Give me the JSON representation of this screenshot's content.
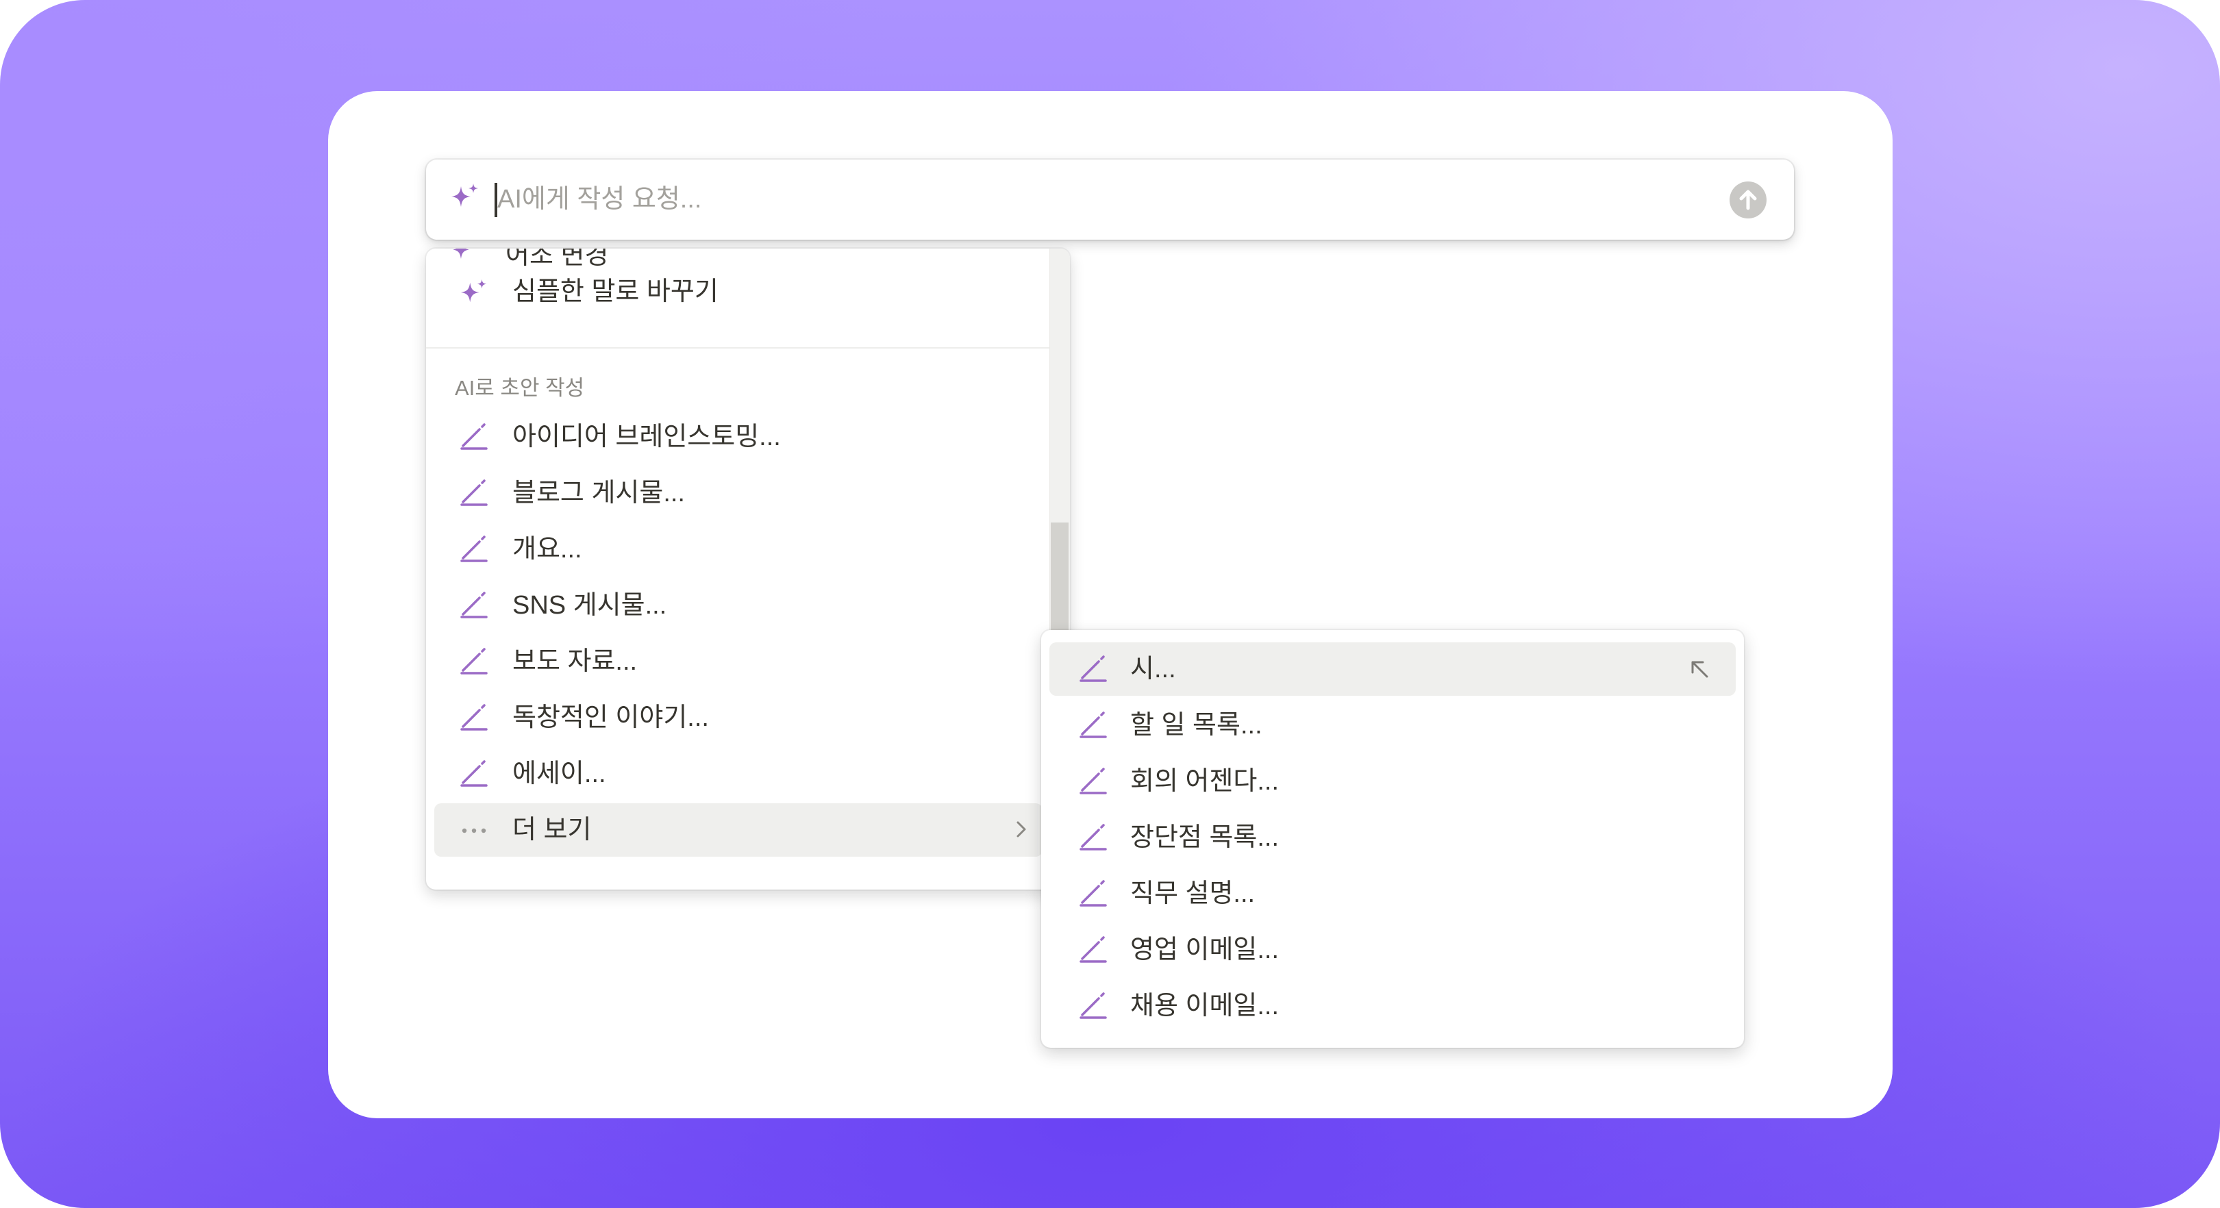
{
  "prompt": {
    "placeholder": "AI에게 작성 요청..."
  },
  "left_menu": {
    "partial_item_label": "어조 변경",
    "items_top": [
      {
        "label": "심플한 말로 바꾸기",
        "icon": "sparkle-icon"
      }
    ],
    "section_title": "AI로 초안 작성",
    "items": [
      {
        "label": "아이디어 브레인스토밍...",
        "icon": "pencil-icon"
      },
      {
        "label": "블로그 게시물...",
        "icon": "pencil-icon"
      },
      {
        "label": "개요...",
        "icon": "pencil-icon"
      },
      {
        "label": "SNS 게시물...",
        "icon": "pencil-icon"
      },
      {
        "label": "보도 자료...",
        "icon": "pencil-icon"
      },
      {
        "label": "독창적인 이야기...",
        "icon": "pencil-icon"
      },
      {
        "label": "에세이...",
        "icon": "pencil-icon"
      }
    ],
    "more": {
      "label": "더 보기",
      "icon": "ellipsis-icon",
      "chevron": "chevron-right-icon"
    }
  },
  "submenu": {
    "items": [
      {
        "label": "시...",
        "icon": "pencil-icon",
        "active": true
      },
      {
        "label": "할 일 목록...",
        "icon": "pencil-icon"
      },
      {
        "label": "회의 어젠다...",
        "icon": "pencil-icon"
      },
      {
        "label": "장단점 목록...",
        "icon": "pencil-icon"
      },
      {
        "label": "직무 설명...",
        "icon": "pencil-icon"
      },
      {
        "label": "영업 이메일...",
        "icon": "pencil-icon"
      },
      {
        "label": "채용 이메일...",
        "icon": "pencil-icon"
      }
    ],
    "active_item_action_icon": "arrow-up-left-icon"
  },
  "colors": {
    "accent_purple": "#9b6bc6",
    "background_gradient_top": "#ab92ff",
    "background_gradient_bottom": "#6a43f4",
    "hover_row": "#efefed"
  }
}
